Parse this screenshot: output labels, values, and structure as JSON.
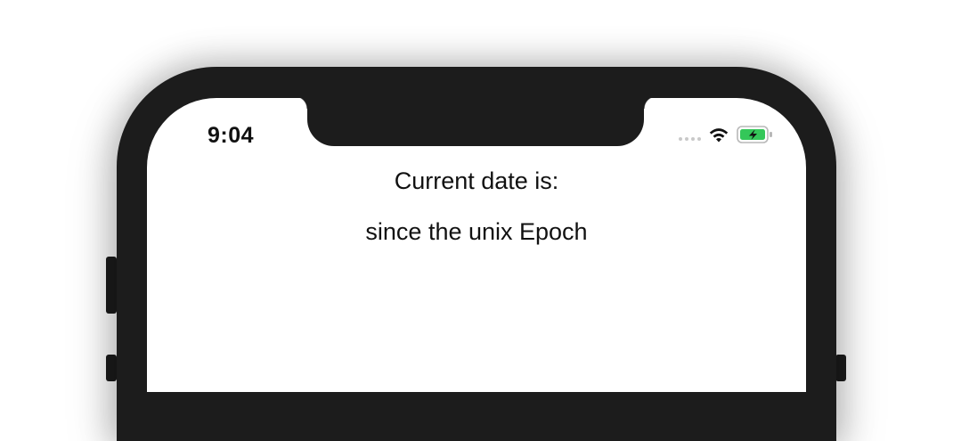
{
  "status_bar": {
    "time": "9:04",
    "icons": [
      "cellular-signal-icon",
      "wifi-icon",
      "battery-charging-icon"
    ],
    "battery_color": "#34c759"
  },
  "main": {
    "date_label": "Current date is:",
    "epoch_label": "since the unix Epoch"
  }
}
